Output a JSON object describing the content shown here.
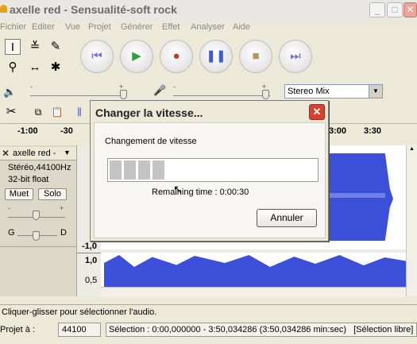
{
  "window": {
    "title": "axelle red - Sensualité-soft rock"
  },
  "menu": [
    "Fichier",
    "Editer",
    "Vue",
    "Projet",
    "Générer",
    "Effet",
    "Analyser",
    "Aide"
  ],
  "transport": {
    "buttons": [
      "skip-to-start",
      "play",
      "record",
      "pause",
      "stop",
      "skip-to-end"
    ]
  },
  "mixer": {
    "input_device": "Stereo Mix",
    "minus": "-",
    "plus": "+"
  },
  "ruler": {
    "labels": [
      "-1:00",
      "-30",
      "0",
      "3:00",
      "3:30"
    ]
  },
  "track": {
    "name": "axelle red -",
    "info1": "Stéréo,44100Hz",
    "info2": "32-bit float",
    "mute": "Muet",
    "solo": "Solo",
    "gain_minus": "-",
    "gain_plus": "+",
    "pan_left": "G",
    "pan_right": "D",
    "scale": [
      "-1,0",
      "1,0",
      "0,5"
    ]
  },
  "dialog": {
    "title": "Changer la vitesse...",
    "message": "Changement de vitesse",
    "progress_fraction": 0.27,
    "remaining": "Remaining time : 0:00:30",
    "cancel": "Annuler"
  },
  "status": {
    "hint": "Cliquer-glisser pour sélectionner l'audio.",
    "rate_label": "Projet à :",
    "rate_value": "44100",
    "selection": "Sélection : 0:00,000000 - 3:50,034286 (3:50,034286 min:sec)",
    "mode": "[Sélection libre]"
  },
  "colors": {
    "waveform": "#3b4fd8",
    "record": "#c0392b",
    "play": "#2e9e3e",
    "pause": "#3c5bd6"
  }
}
